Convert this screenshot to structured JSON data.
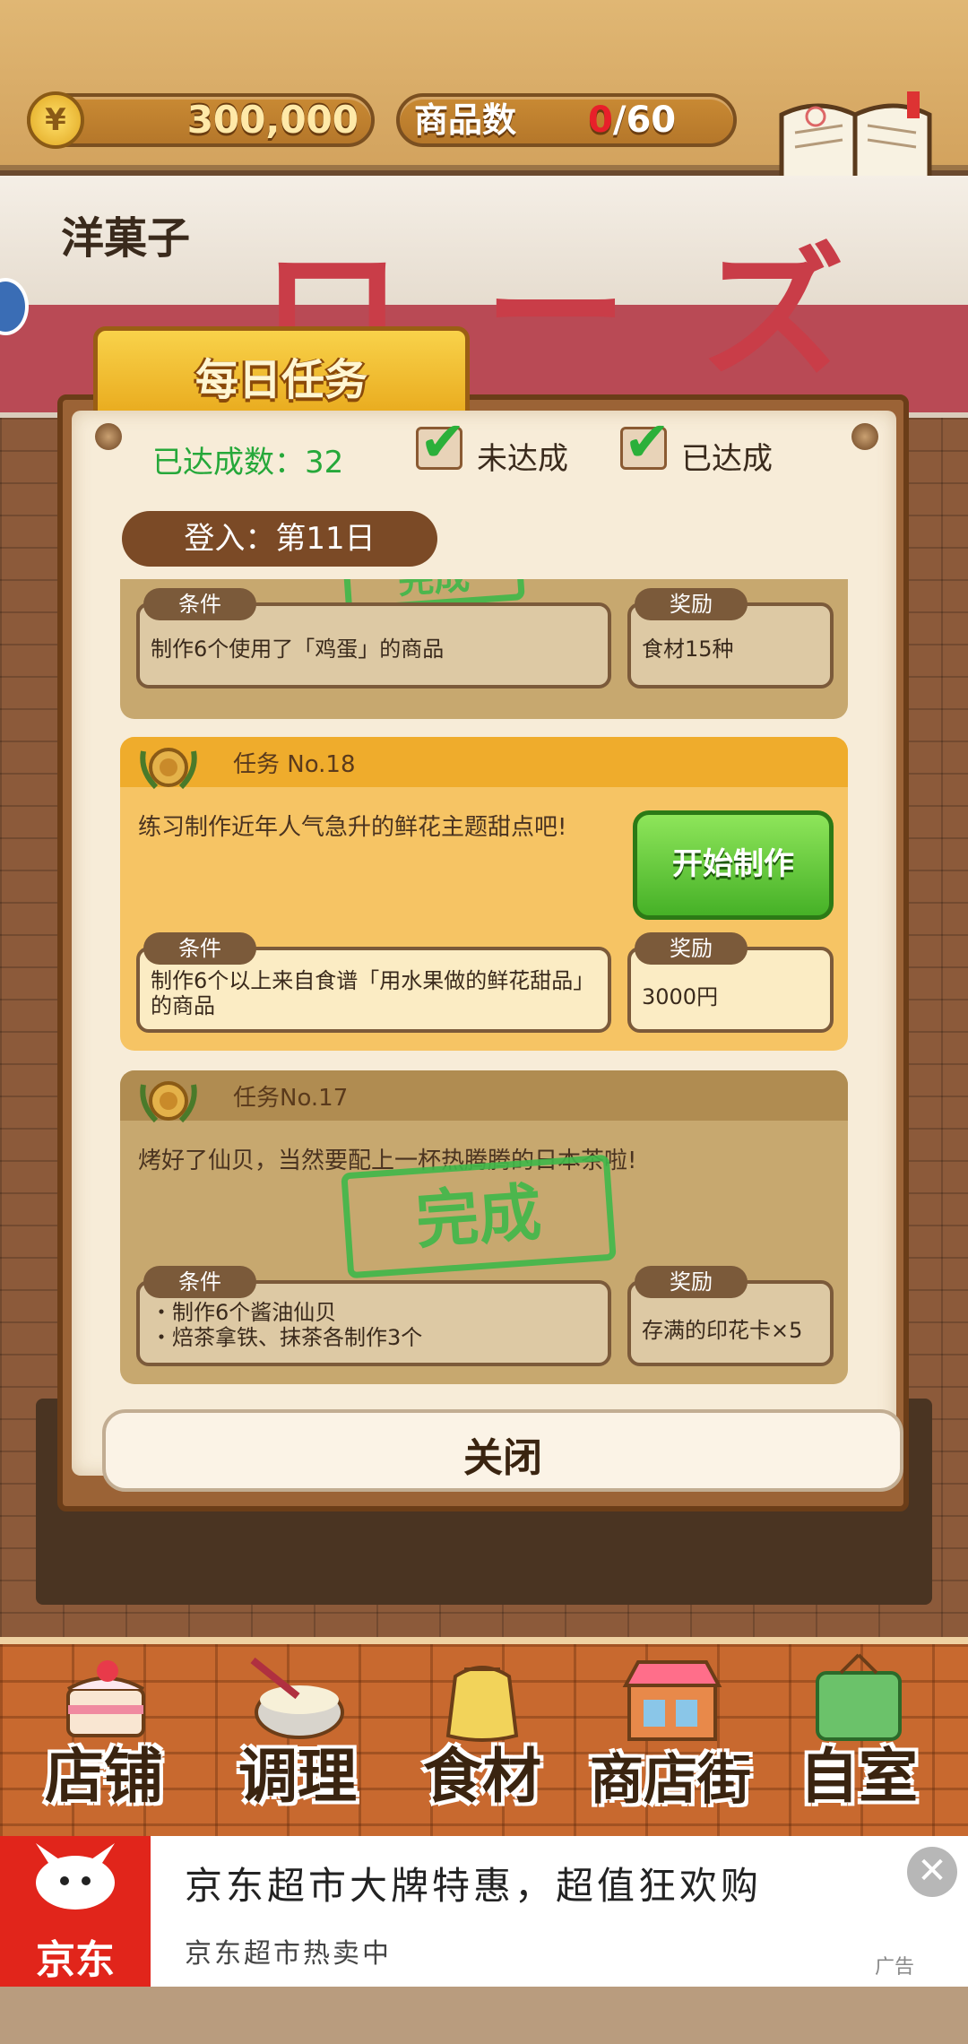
{
  "header": {
    "currency_symbol": "¥",
    "money": "300,000",
    "goods_label": "商品数",
    "goods_current": "0",
    "goods_max": "/60",
    "recipe_label": "食谱"
  },
  "shop": {
    "sign": "洋菓子",
    "banner": "ローズ"
  },
  "panel": {
    "tab_title": "每日任务",
    "completed_count": "已达成数：32",
    "legend_incomplete": "未达成",
    "legend_complete": "已达成",
    "login_day": "登入：第11日",
    "close_label": "关闭"
  },
  "tasks": [
    {
      "condition_tag": "条件",
      "condition": "制作6个使用了「鸡蛋」的商品",
      "reward_tag": "奖励",
      "reward": "食材15种",
      "stamp": "完成"
    },
    {
      "number": "任务 No.18",
      "description": "练习制作近年人气急升的鲜花主题甜点吧!",
      "action": "开始制作",
      "condition_tag": "条件",
      "condition_line1": "制作6个以上来自食谱「用水果做的鲜花甜品」",
      "condition_line2": "的商品",
      "reward_tag": "奖励",
      "reward": "3000円"
    },
    {
      "number": "任务No.17",
      "description": "烤好了仙贝，当然要配上一杯热腾腾的日本茶啦!",
      "stamp": "完成",
      "condition_tag": "条件",
      "condition_line1": "・制作6个酱油仙贝",
      "condition_line2": "・焙茶拿铁、抹茶各制作3个",
      "reward_tag": "奖励",
      "reward": "存满的印花卡×5"
    }
  ],
  "nav": [
    {
      "label": "店铺",
      "icon": "cake-icon"
    },
    {
      "label": "调理",
      "icon": "whisk-bowl-icon"
    },
    {
      "label": "食材",
      "icon": "flour-sack-icon"
    },
    {
      "label": "商店街",
      "icon": "shop-icon"
    },
    {
      "label": "自室",
      "icon": "staff-only-sign-icon"
    }
  ],
  "ad": {
    "logo": "京东",
    "title": "京东超市大牌特惠，超值狂欢购",
    "subtitle": "京东超市热卖中",
    "tag": "广告",
    "close": "✕"
  },
  "colors": {
    "accent_green": "#3fb84a",
    "tab_gold": "#f2c23a",
    "ad_red": "#e1251b"
  }
}
